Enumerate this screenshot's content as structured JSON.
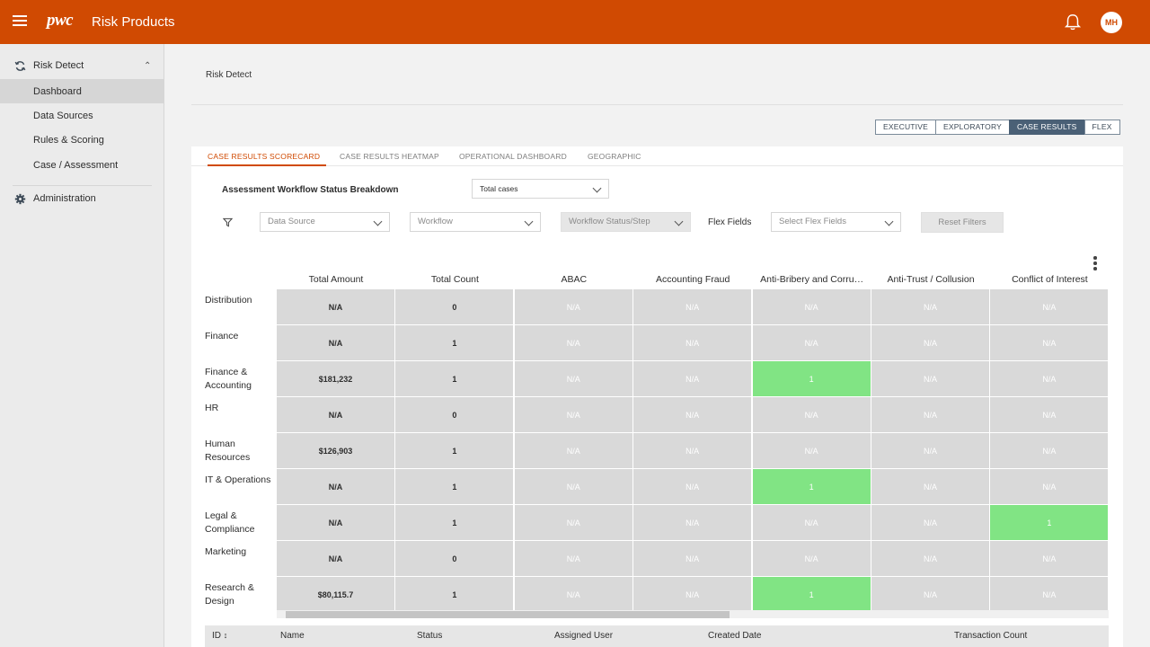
{
  "header": {
    "logo": "pwc",
    "title": "Risk Products",
    "avatar_initials": "MH",
    "brand_color": "#d04a02"
  },
  "sidebar": {
    "section_risk": "Risk Detect",
    "items": [
      {
        "label": "Dashboard"
      },
      {
        "label": "Data Sources"
      },
      {
        "label": "Rules & Scoring"
      },
      {
        "label": "Case / Assessment"
      }
    ],
    "section_admin": "Administration"
  },
  "breadcrumb": "Risk Detect",
  "view_toggle": {
    "options": [
      "EXECUTIVE",
      "EXPLORATORY",
      "CASE RESULTS",
      "FLEX"
    ],
    "selected": "CASE RESULTS"
  },
  "tabs": {
    "items": [
      "CASE RESULTS SCORECARD",
      "CASE RESULTS HEATMAP",
      "OPERATIONAL DASHBOARD",
      "GEOGRAPHIC"
    ],
    "selected": "CASE RESULTS SCORECARD"
  },
  "workflow": {
    "title": "Assessment Workflow Status Breakdown",
    "measure_value": "Total cases"
  },
  "filters": {
    "data_source_placeholder": "Data Source",
    "workflow_placeholder": "Workflow",
    "workflow_status_placeholder": "Workflow Status/Step",
    "flex_fields_label": "Flex Fields",
    "flex_fields_placeholder": "Select Flex Fields",
    "reset_label": "Reset Filters"
  },
  "scorecard": {
    "columns": [
      "Total Amount",
      "Total Count",
      "ABAC",
      "Accounting Fraud",
      "Anti-Bribery and Corru…",
      "Anti-Trust / Collusion",
      "Conflict of Interest"
    ],
    "rows": [
      {
        "label": "Distribution",
        "cells": [
          "N/A",
          "0",
          "N/A",
          "N/A",
          "N/A",
          "N/A",
          "N/A"
        ]
      },
      {
        "label": "Finance",
        "cells": [
          "N/A",
          "1",
          "N/A",
          "N/A",
          "N/A",
          "N/A",
          "N/A"
        ]
      },
      {
        "label": "Finance & Accounting",
        "cells": [
          "$181,232",
          "1",
          "N/A",
          "N/A",
          "1",
          "N/A",
          "N/A"
        ]
      },
      {
        "label": "HR",
        "cells": [
          "N/A",
          "0",
          "N/A",
          "N/A",
          "N/A",
          "N/A",
          "N/A"
        ]
      },
      {
        "label": "Human Resources",
        "cells": [
          "$126,903",
          "1",
          "N/A",
          "N/A",
          "N/A",
          "N/A",
          "N/A"
        ]
      },
      {
        "label": "IT & Operations",
        "cells": [
          "N/A",
          "1",
          "N/A",
          "N/A",
          "1",
          "N/A",
          "N/A"
        ]
      },
      {
        "label": "Legal & Compliance",
        "cells": [
          "N/A",
          "1",
          "N/A",
          "N/A",
          "N/A",
          "N/A",
          "1"
        ]
      },
      {
        "label": "Marketing",
        "cells": [
          "N/A",
          "0",
          "N/A",
          "N/A",
          "N/A",
          "N/A",
          "N/A"
        ]
      },
      {
        "label": "Research & Design",
        "cells": [
          "$80,115.7",
          "1",
          "N/A",
          "N/A",
          "1",
          "N/A",
          "N/A"
        ]
      }
    ],
    "highlight_color": "#81e484",
    "neutral_color": "#d9d9d9"
  },
  "case_table": {
    "columns": [
      "ID",
      "Name",
      "Status",
      "Assigned User",
      "Created Date",
      "Transaction Count"
    ]
  }
}
